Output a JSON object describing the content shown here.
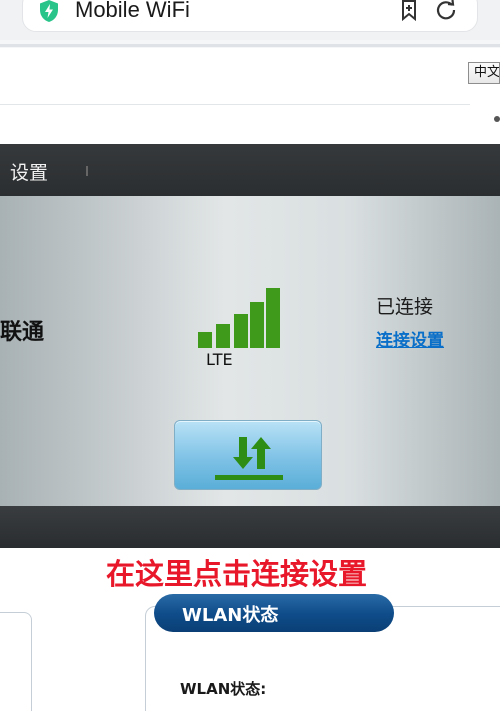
{
  "browser": {
    "site_title": "Mobile WiFi"
  },
  "header": {
    "language": "中文"
  },
  "nav": {
    "settings_label": "设置"
  },
  "status": {
    "carrier": "联通",
    "network_type": "LTE",
    "signal_bars_lit": 5,
    "signal_bars_total": 5,
    "connection_status": "已连接",
    "connection_settings_link": "连接设置"
  },
  "overlay": {
    "caption": "在这里点击连接设置"
  },
  "wlan": {
    "section_title": "WLAN状态",
    "status_label": "WLAN状态:"
  },
  "colors": {
    "signal_green": "#3f9a1c",
    "link_blue": "#0a6fc8",
    "caption_red": "#e8182a",
    "header_navy": "#0f4d8b"
  }
}
